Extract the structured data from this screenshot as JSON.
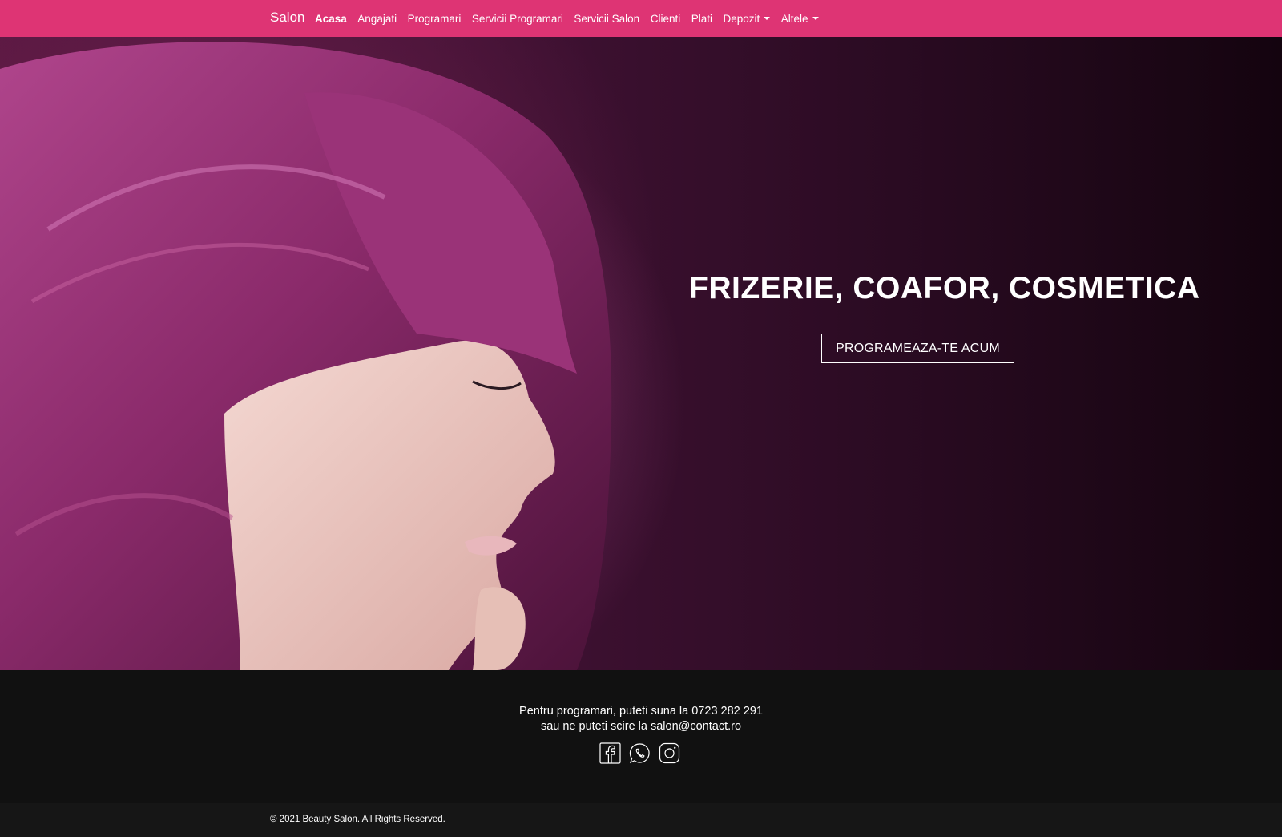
{
  "brand": "Salon",
  "nav": {
    "items": [
      {
        "label": "Acasa"
      },
      {
        "label": "Angajati"
      },
      {
        "label": "Programari"
      },
      {
        "label": "Servicii Programari"
      },
      {
        "label": "Servicii Salon"
      },
      {
        "label": "Clienti"
      },
      {
        "label": "Plati"
      },
      {
        "label": "Depozit"
      },
      {
        "label": "Altele"
      }
    ]
  },
  "hero": {
    "title": "FRIZERIE, COAFOR, COSMETICA",
    "cta": "PROGRAMEAZA-TE ACUM"
  },
  "footer": {
    "line1": "Pentru programari, puteti suna la 0723 282 291",
    "line2": "sau ne puteti scire la salon@contact.ro",
    "social_icons": [
      "facebook-icon",
      "whatsapp-icon",
      "instagram-icon"
    ],
    "copyright": "© 2021 Beauty Salon. All Rights Reserved."
  },
  "colors": {
    "navbar": "#de3474",
    "footer": "#111111",
    "hero_dark": "#2a0b22",
    "hair": "#8a2a6a"
  }
}
